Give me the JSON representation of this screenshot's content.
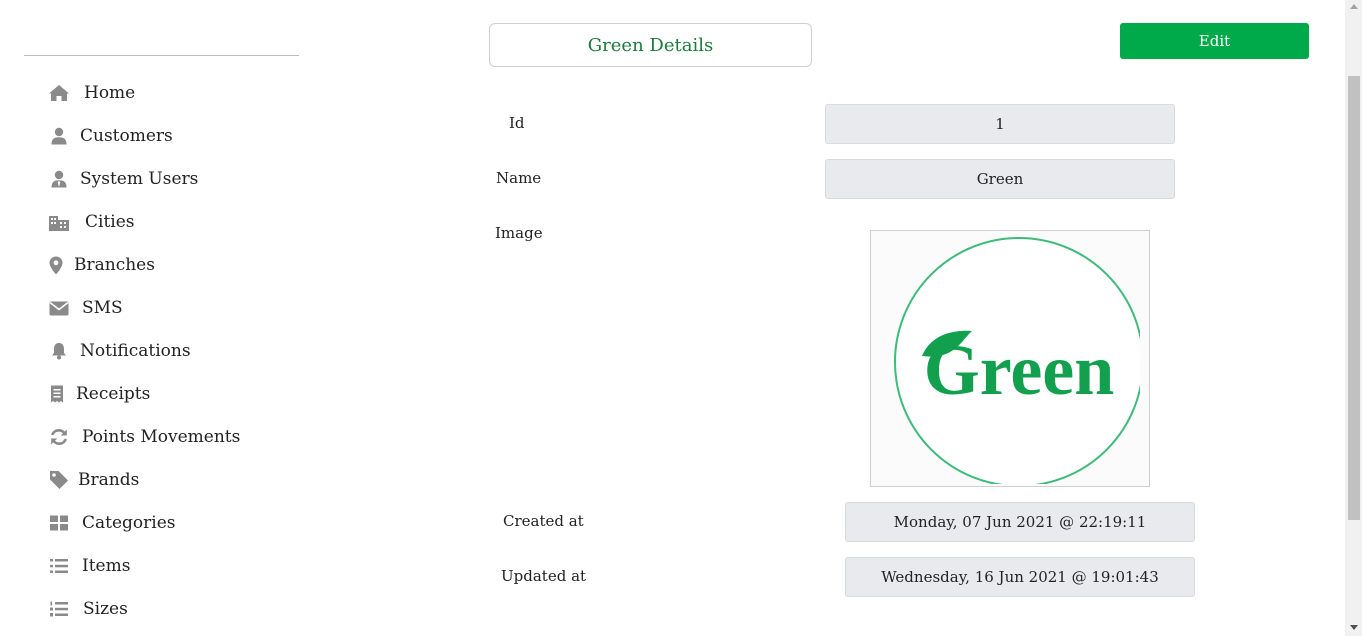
{
  "sidebar": {
    "items": [
      {
        "label": "Home",
        "icon": "home-icon"
      },
      {
        "label": "Customers",
        "icon": "user-icon"
      },
      {
        "label": "System Users",
        "icon": "user-tie-icon"
      },
      {
        "label": "Cities",
        "icon": "city-icon"
      },
      {
        "label": "Branches",
        "icon": "map-marker-icon"
      },
      {
        "label": "SMS",
        "icon": "envelope-icon"
      },
      {
        "label": "Notifications",
        "icon": "bell-icon"
      },
      {
        "label": "Receipts",
        "icon": "receipt-icon"
      },
      {
        "label": "Points Movements",
        "icon": "sync-icon"
      },
      {
        "label": "Brands",
        "icon": "tag-icon"
      },
      {
        "label": "Categories",
        "icon": "grid-icon"
      },
      {
        "label": "Items",
        "icon": "list-icon"
      },
      {
        "label": "Sizes",
        "icon": "ordered-list-icon"
      }
    ]
  },
  "header": {
    "title": "Green Details",
    "edit_label": "Edit"
  },
  "details": {
    "id_label": "Id",
    "id_value": "1",
    "name_label": "Name",
    "name_value": "Green",
    "image_label": "Image",
    "image_logo_text": "Green",
    "created_label": "Created at",
    "created_value": "Monday, 07 Jun 2021 @ 22:19:11",
    "updated_label": "Updated at",
    "updated_value": "Wednesday, 16 Jun 2021 @ 19:01:43"
  },
  "colors": {
    "accent": "#00a94a",
    "title_text": "#1c7a3a",
    "icon_gray": "#8a8a8a",
    "logo_green": "#12a04f"
  }
}
